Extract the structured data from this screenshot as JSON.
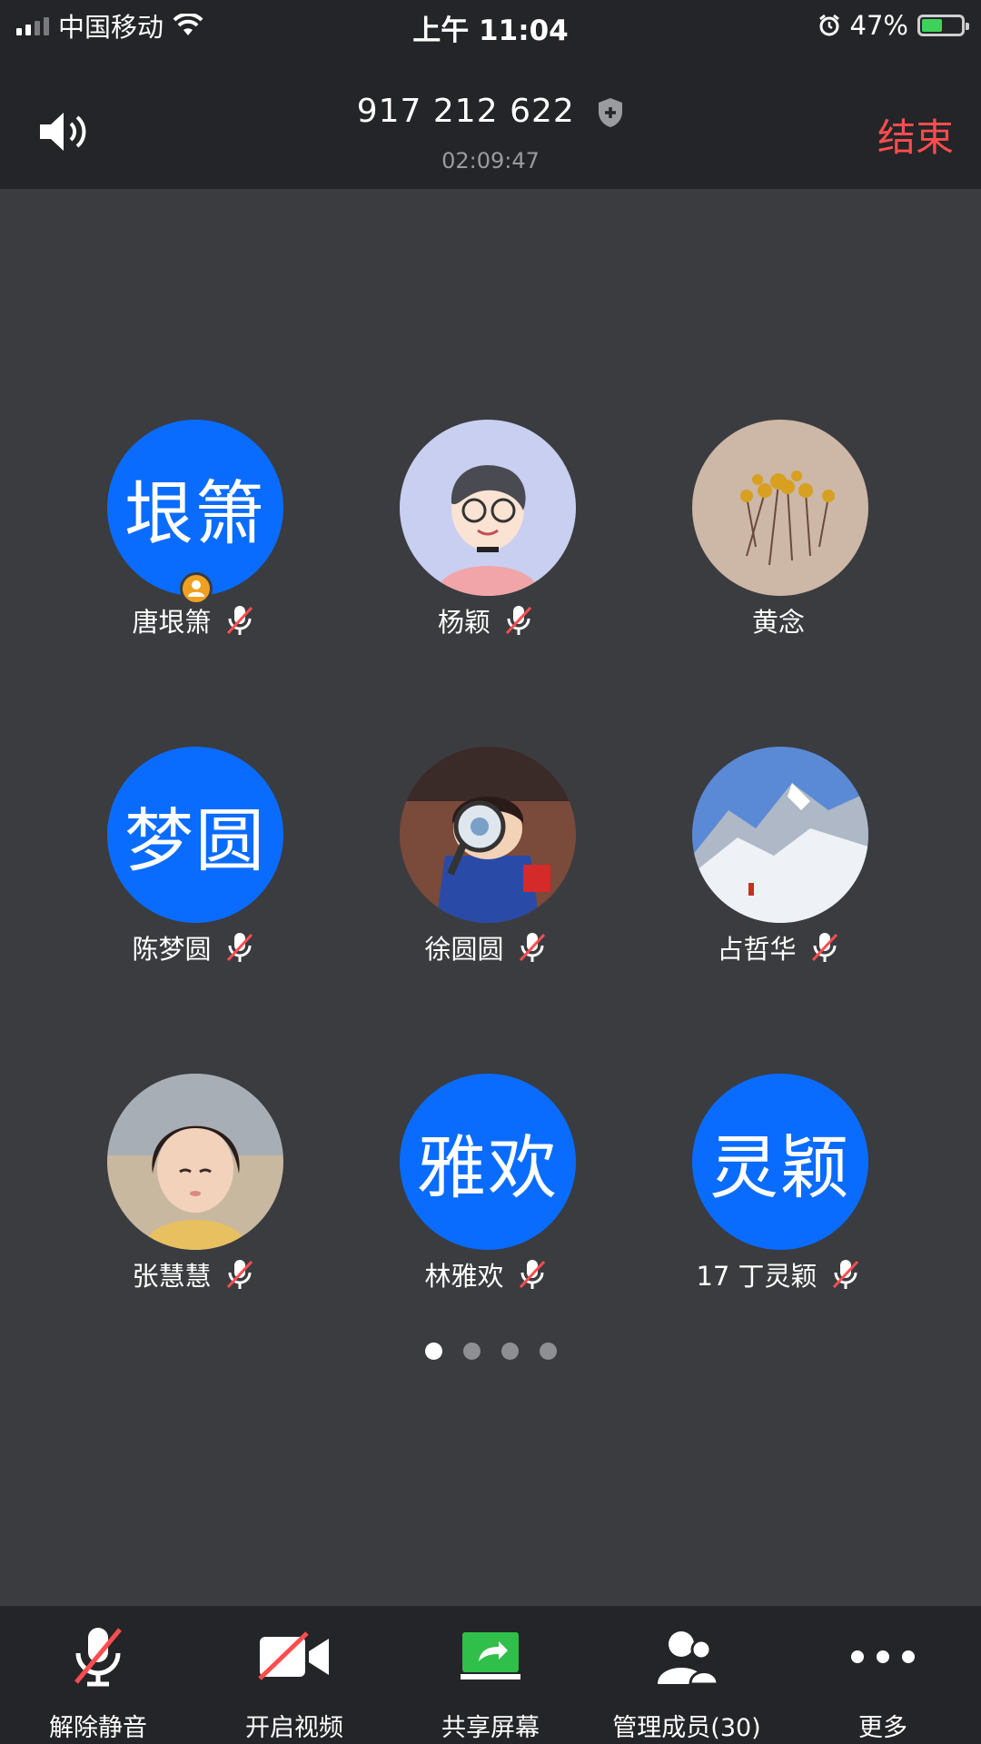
{
  "status_bar": {
    "carrier": "中国移动",
    "time": "上午 11:04",
    "battery": "47%"
  },
  "header": {
    "meeting_id": "917 212 622",
    "duration": "02:09:47",
    "end_label": "结束"
  },
  "participants": [
    {
      "name": "唐垠箫",
      "avatar_text": "垠箫",
      "avatar_type": "text",
      "muted": true,
      "host": true
    },
    {
      "name": "杨颖",
      "avatar_type": "photo",
      "muted": true
    },
    {
      "name": "黄念",
      "avatar_type": "photo",
      "muted": false
    },
    {
      "name": "陈梦圆",
      "avatar_text": "梦圆",
      "avatar_type": "text",
      "muted": true
    },
    {
      "name": "徐圆圆",
      "avatar_type": "photo",
      "muted": true
    },
    {
      "name": "占哲华",
      "avatar_type": "photo",
      "muted": true
    },
    {
      "name": "张慧慧",
      "avatar_type": "photo",
      "muted": true
    },
    {
      "name": "林雅欢",
      "avatar_text": "雅欢",
      "avatar_type": "text",
      "muted": true
    },
    {
      "name": "17 丁灵颖",
      "avatar_text": "灵颖",
      "avatar_type": "text",
      "muted": true
    }
  ],
  "pager": {
    "pages": 4,
    "current": 1
  },
  "toolbar": {
    "unmute": "解除静音",
    "video": "开启视频",
    "share": "共享屏幕",
    "members": "管理成员(30)",
    "more": "更多"
  },
  "colors": {
    "accent_blue": "#0a6cff",
    "end_red": "#ff4d4f",
    "share_green": "#2fbf4a",
    "host_orange": "#f0a020"
  }
}
